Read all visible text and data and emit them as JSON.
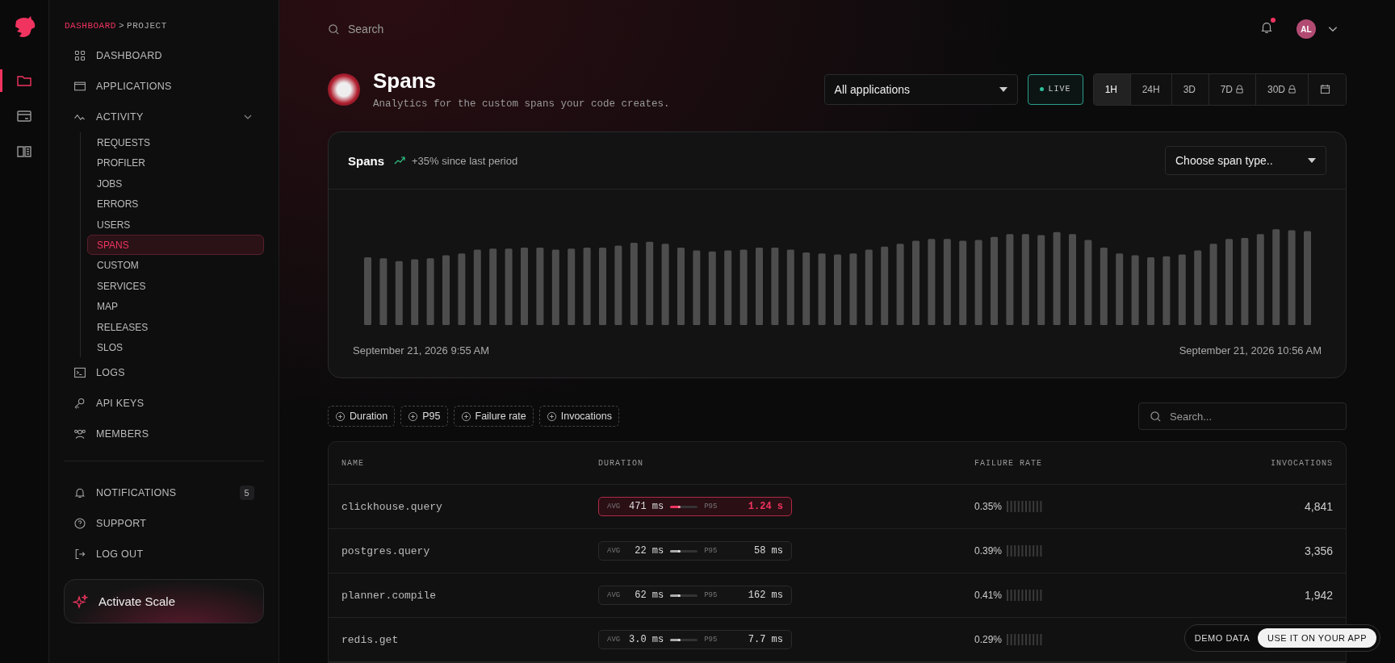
{
  "rail_items": [
    {
      "selected": true
    },
    {
      "selected": false
    },
    {
      "selected": false
    }
  ],
  "breadcrumb": {
    "items": [
      "DASHBOARD",
      "PROJECT"
    ],
    "separator": ">"
  },
  "nav": [
    {
      "label": "DASHBOARD"
    },
    {
      "label": "APPLICATIONS"
    },
    {
      "label": "ACTIVITY",
      "expanded": true,
      "children": [
        {
          "label": "REQUESTS",
          "selected": false
        },
        {
          "label": "PROFILER",
          "selected": false
        },
        {
          "label": "JOBS",
          "selected": false
        },
        {
          "label": "ERRORS",
          "selected": false
        },
        {
          "label": "USERS",
          "selected": false
        },
        {
          "label": "SPANS",
          "selected": true
        },
        {
          "label": "CUSTOM",
          "selected": false
        },
        {
          "label": "SERVICES",
          "selected": false
        },
        {
          "label": "MAP",
          "selected": false
        },
        {
          "label": "RELEASES",
          "selected": false
        },
        {
          "label": "SLOS",
          "selected": false
        }
      ]
    },
    {
      "label": "LOGS"
    },
    {
      "label": "API KEYS"
    },
    {
      "label": "MEMBERS"
    }
  ],
  "footer_nav": [
    {
      "label": "NOTIFICATIONS",
      "badge": "5"
    },
    {
      "label": "SUPPORT"
    },
    {
      "label": "LOG OUT"
    }
  ],
  "upgrade_button": "Activate Scale",
  "search": {
    "placeholder": "Search"
  },
  "notifications_unread": true,
  "avatar": "AL",
  "page": {
    "title": "Spans",
    "subtitle": "Analytics for the custom spans your code creates."
  },
  "app_select": "All applications",
  "live": {
    "label": "LIVE",
    "on": true
  },
  "ranges": [
    {
      "label": "1H",
      "selected": true,
      "locked": false
    },
    {
      "label": "24H",
      "selected": false,
      "locked": false
    },
    {
      "label": "3D",
      "selected": false,
      "locked": false
    },
    {
      "label": "7D",
      "selected": false,
      "locked": true
    },
    {
      "label": "30D",
      "selected": false,
      "locked": true
    }
  ],
  "chart_card": {
    "title": "Spans",
    "trend": "+35% since last period",
    "select_placeholder": "Choose span type..",
    "start": "September 21, 2026 9:55 AM",
    "end": "September 21, 2026 10:56 AM"
  },
  "filters": [
    "Duration",
    "P95",
    "Failure rate",
    "Invocations"
  ],
  "table_search": {
    "placeholder": "Search..."
  },
  "table": {
    "columns": [
      "NAME",
      "DURATION",
      "FAILURE RATE",
      "INVOCATIONS"
    ],
    "rows": [
      {
        "name": "clickhouse.query",
        "avg": "471 ms",
        "p95": "1.24 s",
        "level": 0.38,
        "alert": true,
        "avg_label": "AVG",
        "p95_label": "P95",
        "failure_rate": "0.35%",
        "invocations": "4,841"
      },
      {
        "name": "postgres.query",
        "avg": "22 ms",
        "p95": "58 ms",
        "level": 0.38,
        "alert": false,
        "avg_label": "AVG",
        "p95_label": "P95",
        "failure_rate": "0.39%",
        "invocations": "3,356"
      },
      {
        "name": "planner.compile",
        "avg": "62 ms",
        "p95": "162 ms",
        "level": 0.38,
        "alert": false,
        "avg_label": "AVG",
        "p95_label": "P95",
        "failure_rate": "0.41%",
        "invocations": "1,942"
      },
      {
        "name": "redis.get",
        "avg": "3.0 ms",
        "p95": "7.7 ms",
        "level": 0.38,
        "alert": false,
        "avg_label": "AVG",
        "p95_label": "P95",
        "failure_rate": "0.29%"
      }
    ]
  },
  "demo": {
    "label": "DEMO DATA",
    "button": "USE IT ON YOUR APP"
  }
}
